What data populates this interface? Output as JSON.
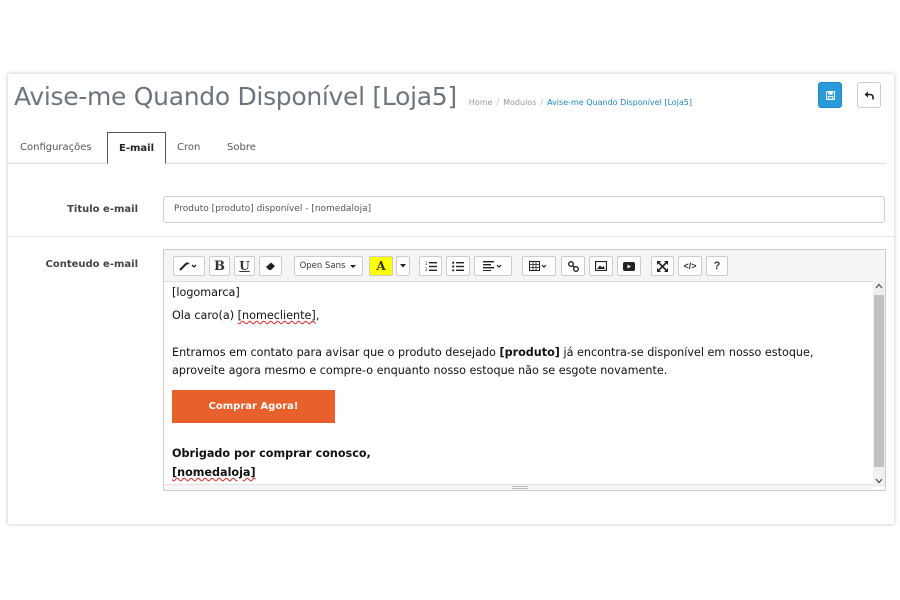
{
  "header": {
    "title": "Avise-me Quando Disponível [Loja5]",
    "breadcrumb": [
      "Home",
      "Modulos",
      "Avise-me Quando Disponível [Loja5]"
    ],
    "accent_color": "#2a9ad9"
  },
  "tabs": [
    {
      "label": "Configurações"
    },
    {
      "label": "E-mail",
      "active": true
    },
    {
      "label": "Cron"
    },
    {
      "label": "Sobre"
    }
  ],
  "form": {
    "title_label": "Titulo e-mail",
    "title_value": "Produto [produto] disponível - [nomedaloja]",
    "content_label": "Conteudo e-mail"
  },
  "toolbar": {
    "font_name": "Open Sans",
    "buttons": [
      "magic-icon",
      "bold-icon",
      "underline-icon",
      "eraser-icon",
      "font-select",
      "text-color-icon",
      "ordered-list-icon",
      "unordered-list-icon",
      "align-icon",
      "table-icon",
      "link-icon",
      "picture-icon",
      "video-icon",
      "fullscreen-icon",
      "code-view-icon",
      "help-icon"
    ]
  },
  "editor": {
    "line1": "[logomarca]",
    "greeting_prefix": "Ola caro(a) ",
    "greeting_var": "[nomecliente]",
    "greeting_suffix": ",",
    "body_prefix": "Entramos em contato para avisar que o produto desejado ",
    "body_var": "[produto]",
    "body_suffix": " já encontra-se disponível em nosso estoque, aproveite agora mesmo e compre-o enquanto nosso estoque não se esgote novamente.",
    "cta_label": "Comprar Agora!",
    "cta_color": "#e8602c",
    "thanks": "Obrigado por comprar conosco,",
    "signature": "[nomedaloja]"
  }
}
